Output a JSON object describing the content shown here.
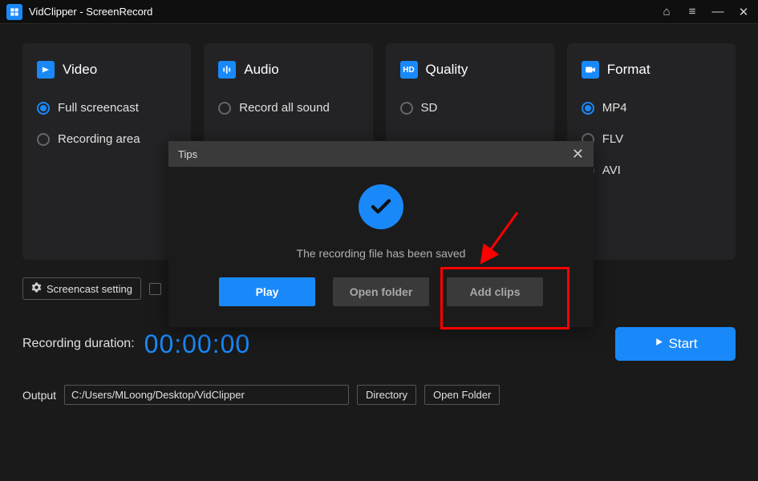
{
  "titlebar": {
    "title": "VidClipper - ScreenRecord"
  },
  "panels": {
    "video": {
      "title": "Video",
      "options": [
        "Full screencast",
        "Recording area"
      ],
      "selected": 0
    },
    "audio": {
      "title": "Audio",
      "options": [
        "Record all sound"
      ],
      "selected": -1
    },
    "quality": {
      "title": "Quality",
      "options": [
        "SD"
      ],
      "selected": -1
    },
    "format": {
      "title": "Format",
      "options": [
        "MP4",
        "FLV",
        "AVI"
      ],
      "selected": 0
    }
  },
  "toolbar": {
    "screencast_setting": "Screencast setting"
  },
  "duration": {
    "label": "Recording duration:",
    "time": "00:00:00"
  },
  "start": {
    "label": "Start"
  },
  "output": {
    "label": "Output",
    "path": "C:/Users/MLoong/Desktop/VidClipper",
    "directory_btn": "Directory",
    "open_folder_btn": "Open Folder"
  },
  "modal": {
    "title": "Tips",
    "message": "The recording file has been saved",
    "play_btn": "Play",
    "open_folder_btn": "Open folder",
    "add_clips_btn": "Add clips"
  }
}
